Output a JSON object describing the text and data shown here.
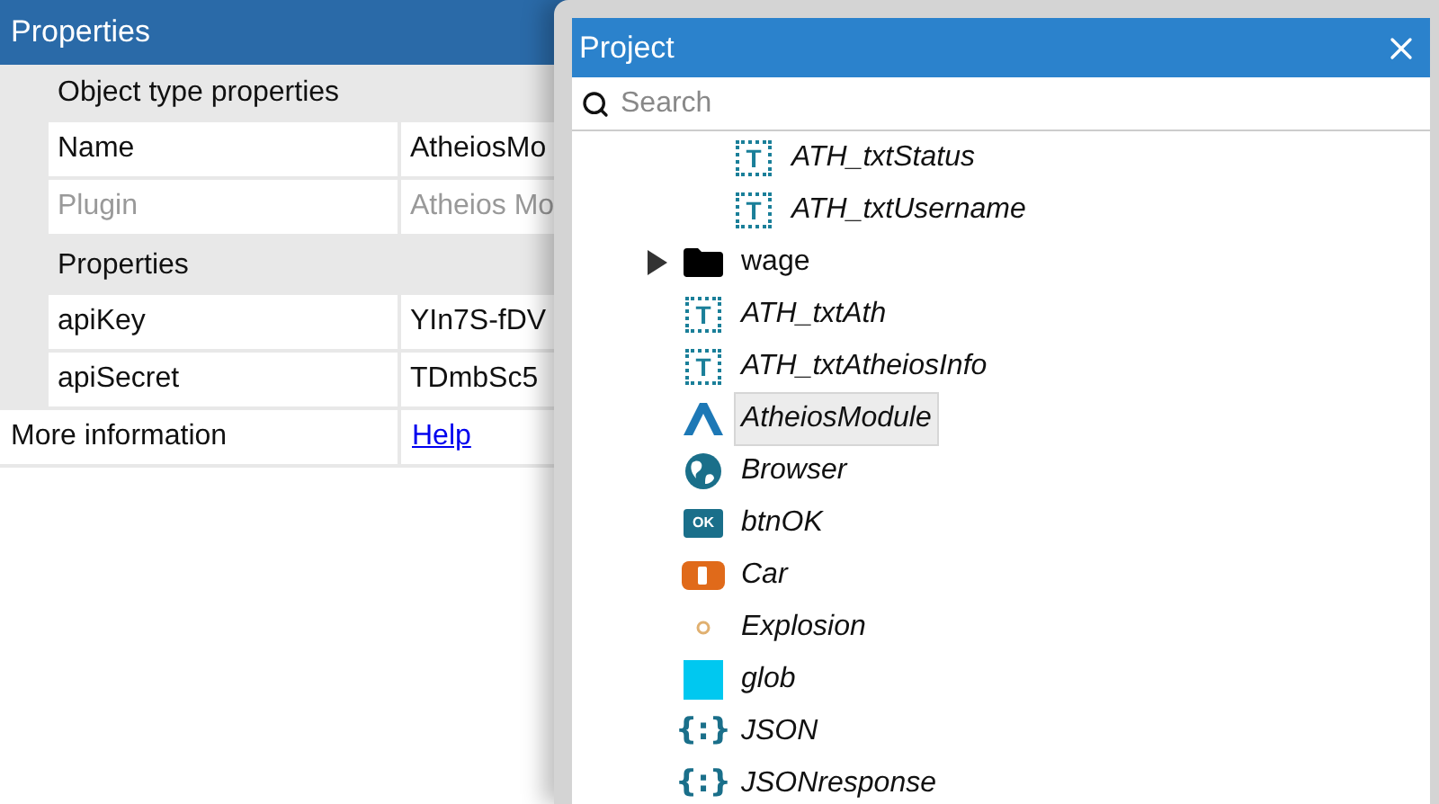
{
  "properties_panel": {
    "title": "Properties",
    "sections": [
      {
        "heading": "Object type properties",
        "rows": [
          {
            "name": "Name",
            "value": "AtheiosMo",
            "disabled": false
          },
          {
            "name": "Plugin",
            "value": "Atheios Mo",
            "disabled": true
          }
        ]
      },
      {
        "heading": "Properties",
        "rows": [
          {
            "name": "apiKey",
            "value": "YIn7S-fDV",
            "disabled": false
          },
          {
            "name": "apiSecret",
            "value": "TDmbSc5",
            "disabled": false
          }
        ]
      }
    ],
    "footer": {
      "label": "More information",
      "link": "Help"
    }
  },
  "project_panel": {
    "title": "Project",
    "search": {
      "placeholder": "Search"
    },
    "tree": [
      {
        "kind": "group",
        "children": [
          {
            "kind": "text",
            "icon_text": "T",
            "label": "ATH_txtStatus",
            "selected": false
          },
          {
            "kind": "text",
            "icon_text": "T",
            "label": "ATH_txtUsername",
            "selected": false
          }
        ]
      },
      {
        "kind": "folder",
        "label": "wage",
        "expanded": false,
        "selected": false
      },
      {
        "kind": "text",
        "icon_text": "T",
        "label": "ATH_txtAth",
        "selected": false
      },
      {
        "kind": "text",
        "icon_text": "T",
        "label": "ATH_txtAtheiosInfo",
        "selected": false
      },
      {
        "kind": "module",
        "label": "AtheiosModule",
        "selected": true
      },
      {
        "kind": "browser",
        "label": "Browser",
        "selected": false
      },
      {
        "kind": "button",
        "icon_text": "OK",
        "label": "btnOK",
        "selected": false
      },
      {
        "kind": "car",
        "label": "Car",
        "selected": false
      },
      {
        "kind": "explosion",
        "label": "Explosion",
        "selected": false
      },
      {
        "kind": "glob",
        "label": "glob",
        "selected": false
      },
      {
        "kind": "json",
        "icon_text": "{:}",
        "label": "JSON",
        "selected": false
      },
      {
        "kind": "json",
        "icon_text": "{:}",
        "label": "JSONresponse",
        "selected": false
      }
    ]
  }
}
